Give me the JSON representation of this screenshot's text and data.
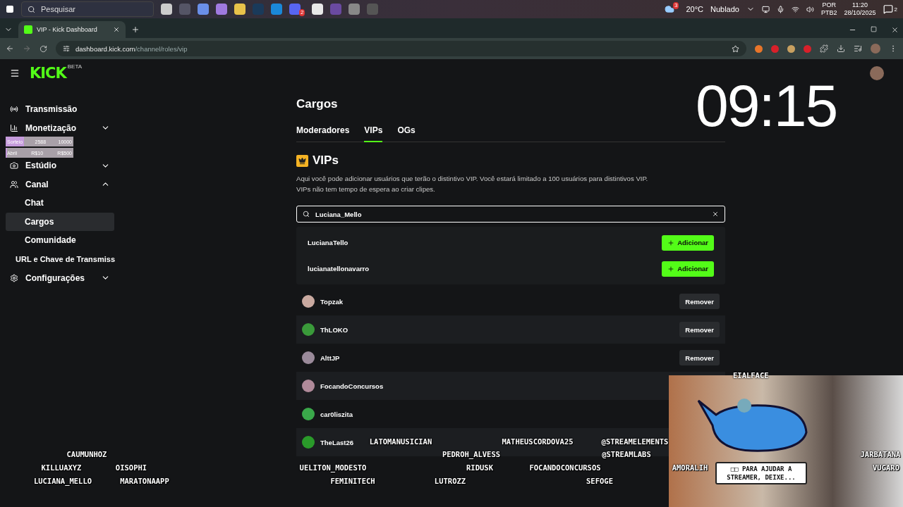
{
  "taskbar": {
    "search_placeholder": "Pesquisar",
    "weather_badge": "3",
    "temperature": "20°C",
    "condition": "Nublado",
    "language": "POR",
    "layout": "PTB2",
    "time": "11:20",
    "date": "28/10/2025",
    "notifications": "2",
    "discord_badge": "2"
  },
  "browser": {
    "tab_title": "VIP - Kick Dashboard",
    "url_host": "dashboard.kick.com",
    "url_path": "/channel/roles/vip"
  },
  "header": {
    "logo": "KICK",
    "logo_badge": "BETA"
  },
  "sidebar": {
    "items": [
      {
        "label": "Transmissão"
      },
      {
        "label": "Monetização",
        "expanded": false
      },
      {
        "label": "Estúdio",
        "expanded": false
      },
      {
        "label": "Canal",
        "expanded": true,
        "children": [
          {
            "label": "Chat",
            "selected": false
          },
          {
            "label": "Cargos",
            "selected": true
          },
          {
            "label": "Comunidade",
            "selected": false
          },
          {
            "label": "URL e Chave de Transmiss",
            "selected": false
          }
        ]
      },
      {
        "label": "Configurações",
        "expanded": false
      }
    ]
  },
  "goal_widget": [
    {
      "label": "Sorteio",
      "current": "2588",
      "target": "10000",
      "level": 0.27
    },
    {
      "label": "Abril",
      "current": "R$10",
      "target": "R$500",
      "level": 0.02
    }
  ],
  "main": {
    "title": "Cargos",
    "tabs": [
      {
        "label": "Moderadores",
        "selected": false
      },
      {
        "label": "VIPs",
        "selected": true
      },
      {
        "label": "OGs",
        "selected": false
      }
    ],
    "section_title": "VIPs",
    "description": [
      "Aqui você pode adicionar usuários que terão o distintivo VIP. Você estará limitado a 100 usuários para distintivos VIP.",
      "VIPs não tem tempo de espera ao criar clipes."
    ],
    "search": {
      "value": "Luciana_Mello"
    },
    "results": [
      {
        "name": "LucianaTello",
        "action": "Adicionar"
      },
      {
        "name": "lucianatellonavarro",
        "action": "Adicionar"
      }
    ],
    "vips": [
      {
        "name": "Topzak",
        "action": "Remover"
      },
      {
        "name": "ThLOKO",
        "action": "Remover"
      },
      {
        "name": "AlttJP",
        "action": "Remover"
      },
      {
        "name": "FocandoConcursos"
      },
      {
        "name": "car0liszita"
      },
      {
        "name": "TheLast26"
      }
    ]
  },
  "clock": "09:15",
  "webcam": {
    "title": "EIALFACE",
    "banner": "□□ PARA AJUDAR A STREAMER, DEIXE..."
  },
  "chat_names": [
    "CAUMUNHOZ",
    "KILLUAXYZ",
    "OISOPHI",
    "LUCIANA_MELLO",
    "MARATONAAPP",
    "LATOMANUSICIAN",
    "MATHEUSCORDOVA25",
    "@STREAMELEMENTS",
    "PEDROH_ALVESS",
    "@STREAMLABS",
    "UELITON_MODESTO",
    "RIDUSK",
    "FOCANDOCONCURSOS",
    "AMORALIH",
    "FEMINITECH",
    "LUTROZZ",
    "SEFOGE",
    "JARBATANA",
    "VUGARO"
  ]
}
